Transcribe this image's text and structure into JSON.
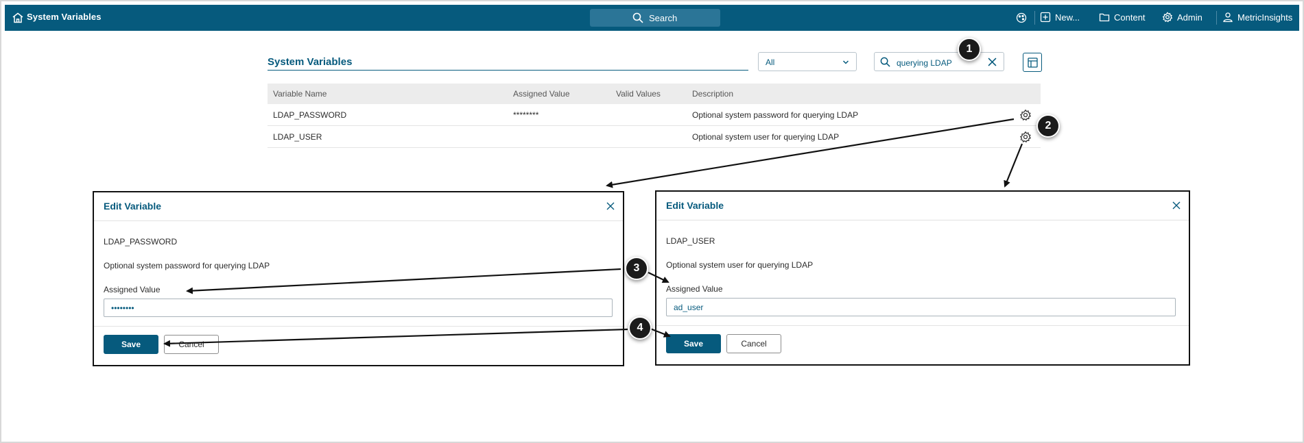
{
  "topbar": {
    "title": "System Variables",
    "search_label": "Search",
    "nav": {
      "new_label": "New...",
      "content_label": "Content",
      "admin_label": "Admin",
      "user_label": "MetricInsights"
    }
  },
  "toolbar": {
    "page_title": "System Variables",
    "filter_select_value": "All",
    "search_value": "querying LDAP"
  },
  "table": {
    "headers": [
      "Variable Name",
      "Assigned Value",
      "Valid Values",
      "Description"
    ],
    "rows": [
      {
        "name": "LDAP_PASSWORD",
        "assigned": "********",
        "valid": "",
        "description": "Optional system password for querying LDAP"
      },
      {
        "name": "LDAP_USER",
        "assigned": "",
        "valid": "",
        "description": "Optional system user for querying LDAP"
      }
    ]
  },
  "dialogs": [
    {
      "title": "Edit Variable",
      "variable_name": "LDAP_PASSWORD",
      "description": "Optional system password for querying LDAP",
      "assigned_label": "Assigned Value",
      "assigned_value": "••••••••",
      "save_label": "Save",
      "cancel_label": "Cancel"
    },
    {
      "title": "Edit Variable",
      "variable_name": "LDAP_USER",
      "description": "Optional system user for querying LDAP",
      "assigned_label": "Assigned Value",
      "assigned_value": "ad_user",
      "save_label": "Save",
      "cancel_label": "Cancel"
    }
  ],
  "callouts": [
    "1",
    "2",
    "3",
    "4"
  ],
  "colors": {
    "brand": "#065a7d",
    "search_bg": "#2b7597",
    "callout": "#1b1b1b"
  },
  "icons": [
    "home-icon",
    "search-icon",
    "palette-icon",
    "plus-square-icon",
    "folder-icon",
    "gear-icon",
    "user-icon",
    "chevron-down-icon",
    "close-icon",
    "table-layout-icon"
  ]
}
